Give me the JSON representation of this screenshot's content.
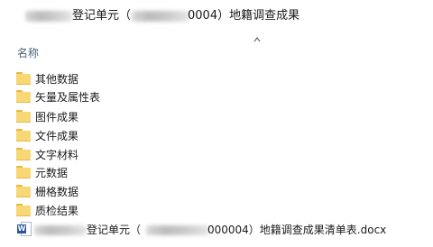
{
  "title_bar": {
    "part1": "登记单元（",
    "part2": "0004）地籍调查成果"
  },
  "column_header": {
    "name_label": "名称"
  },
  "folders": [
    {
      "label": "其他数据",
      "icon": "folder-icon"
    },
    {
      "label": "矢量及属性表",
      "icon": "folder-icon"
    },
    {
      "label": "图件成果",
      "icon": "folder-icon"
    },
    {
      "label": "文件成果",
      "icon": "folder-icon"
    },
    {
      "label": "文字材料",
      "icon": "folder-icon"
    },
    {
      "label": "元数据",
      "icon": "folder-icon"
    },
    {
      "label": "栅格数据",
      "icon": "folder-icon"
    },
    {
      "label": "质检结果",
      "icon": "folder-icon"
    }
  ],
  "file": {
    "part1": "登记单元（",
    "part2": "000004）地籍调查成果清单表.docx",
    "icon": "word-doc-icon",
    "badge": "W"
  },
  "colors": {
    "folder": "#f8d775",
    "word": "#2b579a"
  }
}
